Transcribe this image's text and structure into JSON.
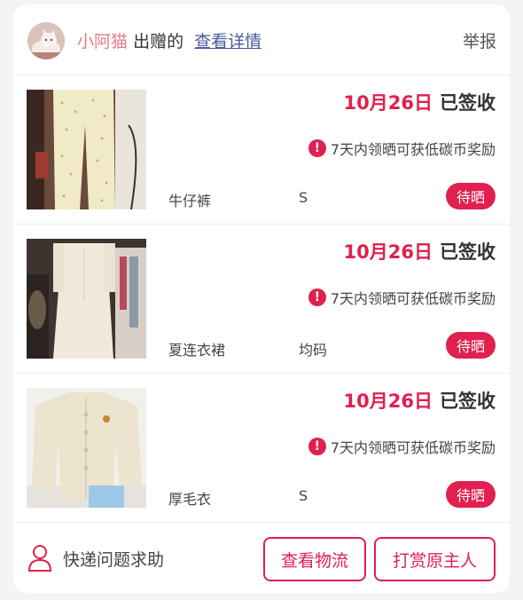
{
  "header": {
    "giver_name": "小阿猫",
    "giver_suffix": "出赠的",
    "detail_link": "查看详情",
    "report": "举报"
  },
  "items": [
    {
      "date": "10月26日",
      "signed": "已签收",
      "reward_text": "7天内领晒可获低碳币奖励",
      "name": "牛仔裤",
      "size": "S",
      "status": "待晒"
    },
    {
      "date": "10月26日",
      "signed": "已签收",
      "reward_text": "7天内领晒可获低碳币奖励",
      "name": "夏连衣裙",
      "size": "均码",
      "status": "待晒"
    },
    {
      "date": "10月26日",
      "signed": "已签收",
      "reward_text": "7天内领晒可获低碳币奖励",
      "name": "厚毛衣",
      "size": "S",
      "status": "待晒"
    }
  ],
  "footer": {
    "help": "快递问题求助",
    "logistics_button": "查看物流",
    "tip_button": "打赏原主人"
  },
  "colors": {
    "accent": "#e0204f",
    "giver_name": "#e87a86",
    "link": "#4a5a9c"
  },
  "icons": {
    "alert": "exclamation-circle-icon",
    "help": "user-outline-icon"
  }
}
